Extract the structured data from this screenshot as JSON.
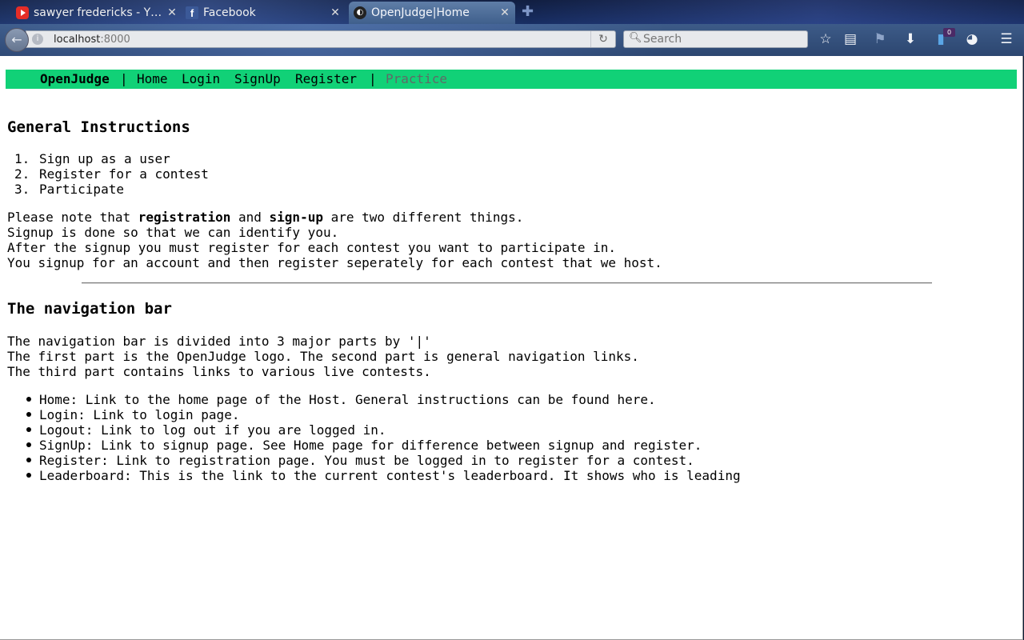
{
  "browser": {
    "tabs": [
      {
        "title": "sawyer fredericks - Y…",
        "icon": "youtube-icon"
      },
      {
        "title": "Facebook",
        "icon": "facebook-icon"
      },
      {
        "title": "OpenJudge|Home",
        "icon": "openjudge-icon",
        "active": true
      }
    ],
    "url_host": "localhost",
    "url_port": ":8000",
    "search_placeholder": "Search",
    "download_badge": "0"
  },
  "site_nav": {
    "brand": "OpenJudge",
    "sep1": "|",
    "home": "Home",
    "login": "Login",
    "signup": "SignUp",
    "register": "Register",
    "sep2": "|",
    "practice": "Practice"
  },
  "instructions": {
    "heading": "General Instructions",
    "steps": [
      "Sign up as a user",
      "Register for a contest",
      "Participate"
    ],
    "note_prefix": "Please note that ",
    "note_bold1": "registration",
    "note_and": " and ",
    "note_bold2": "sign-up",
    "note_suffix": " are two different things.",
    "lines": [
      "Signup is done so that we can identify you.",
      "After the signup you must register for each contest you want to participate in.",
      "You signup for an account and then register seperately for each contest that we host."
    ]
  },
  "navigation": {
    "heading": "The navigation bar",
    "lines": [
      "The navigation bar is divided into 3 major parts by '|'",
      "The first part is the OpenJudge logo. The second part is general navigation links.",
      "The third part contains links to various live contests."
    ],
    "bullets": [
      "Home: Link to the home page of the Host. General instructions can be found here.",
      "Login: Link to login page.",
      "Logout: Link to log out if you are logged in.",
      "SignUp: Link to signup page. See Home page for difference between signup and register.",
      "Register: Link to registration page. You must be logged in to register for a contest.",
      "Leaderboard: This is the link to the current contest's leaderboard. It shows who is leading"
    ]
  },
  "colors": {
    "nav_green": "#11d177",
    "muted_link": "#5f6b68"
  }
}
